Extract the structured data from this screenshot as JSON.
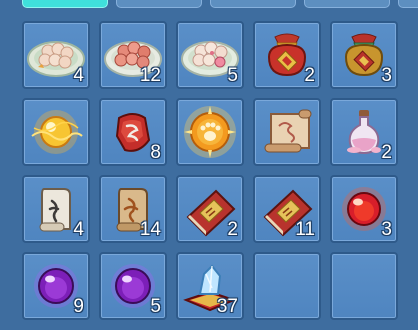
{
  "inventory": {
    "tabs": [
      "",
      "",
      "",
      "",
      ""
    ],
    "slots": [
      {
        "item": "rice-ball-plate-icon",
        "count": "4"
      },
      {
        "item": "meatball-plate-icon",
        "count": "12"
      },
      {
        "item": "dumpling-plate-icon",
        "count": "5"
      },
      {
        "item": "red-lucky-bag-icon",
        "count": "2"
      },
      {
        "item": "gold-lucky-bag-icon",
        "count": "3"
      },
      {
        "item": "golden-energy-orb-icon",
        "count": ""
      },
      {
        "item": "red-rune-stone-icon",
        "count": "8"
      },
      {
        "item": "paw-sunburst-orb-icon",
        "count": ""
      },
      {
        "item": "parchment-scroll-icon",
        "count": ""
      },
      {
        "item": "pink-potion-bottle-icon",
        "count": "2"
      },
      {
        "item": "white-rune-scroll-icon",
        "count": "4"
      },
      {
        "item": "tan-rune-scroll-icon",
        "count": "14"
      },
      {
        "item": "red-seal-book-icon",
        "count": "2"
      },
      {
        "item": "red-seal-book-icon",
        "count": "11"
      },
      {
        "item": "red-crystal-orb-icon",
        "count": "3"
      },
      {
        "item": "purple-crystal-orb-icon",
        "count": "9"
      },
      {
        "item": "purple-crystal-orb-icon",
        "count": "5"
      },
      {
        "item": "blue-crystal-pillow-icon",
        "count": "37"
      },
      {
        "item": "",
        "count": ""
      },
      {
        "item": "",
        "count": ""
      }
    ]
  },
  "colors": {
    "background": "#3e6d9f",
    "slot": "#5589c4",
    "slot_border": "#2e5a8a",
    "active_tab": "#3fe0dc"
  }
}
